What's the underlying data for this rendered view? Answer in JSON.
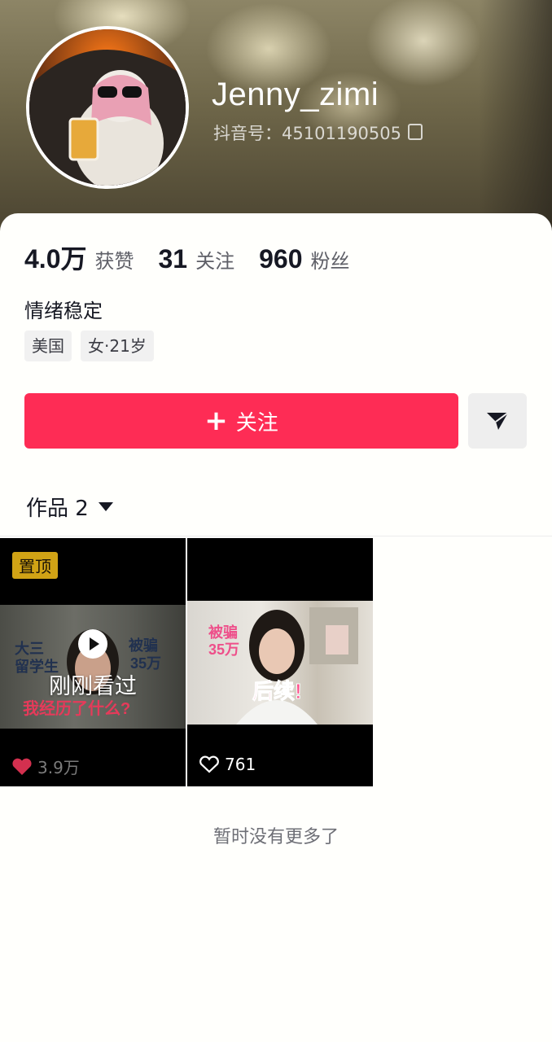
{
  "profile": {
    "username": "Jenny_zimi",
    "douyin_id": "抖音号：45101190505",
    "bio": "情绪稳定",
    "tags": [
      "美国",
      "女·21岁"
    ]
  },
  "stats": [
    {
      "num": "4.0万",
      "label": "获赞"
    },
    {
      "num": "31",
      "label": "关注"
    },
    {
      "num": "960",
      "label": "粉丝"
    }
  ],
  "actions": {
    "follow_label": "关注",
    "follow_icon": "plus-icon",
    "message_icon": "send-icon"
  },
  "works": {
    "tab_label": "作品 2",
    "items": [
      {
        "pinned_label": "置顶",
        "overlay_text": "刚刚看过",
        "thumb_texts": [
          "大三",
          "留学生",
          "被骗",
          "35万",
          "我经历了什么?"
        ],
        "likes": "3.9万",
        "liked": true
      },
      {
        "thumb_texts": [
          "被骗",
          "35万",
          "后续!"
        ],
        "likes": "761",
        "liked": false
      }
    ],
    "empty_text": "暂时没有更多了"
  },
  "colors": {
    "accent": "#fe2c55",
    "pinned_badge": "#e8b518",
    "liked_heart": "#d3304f"
  }
}
